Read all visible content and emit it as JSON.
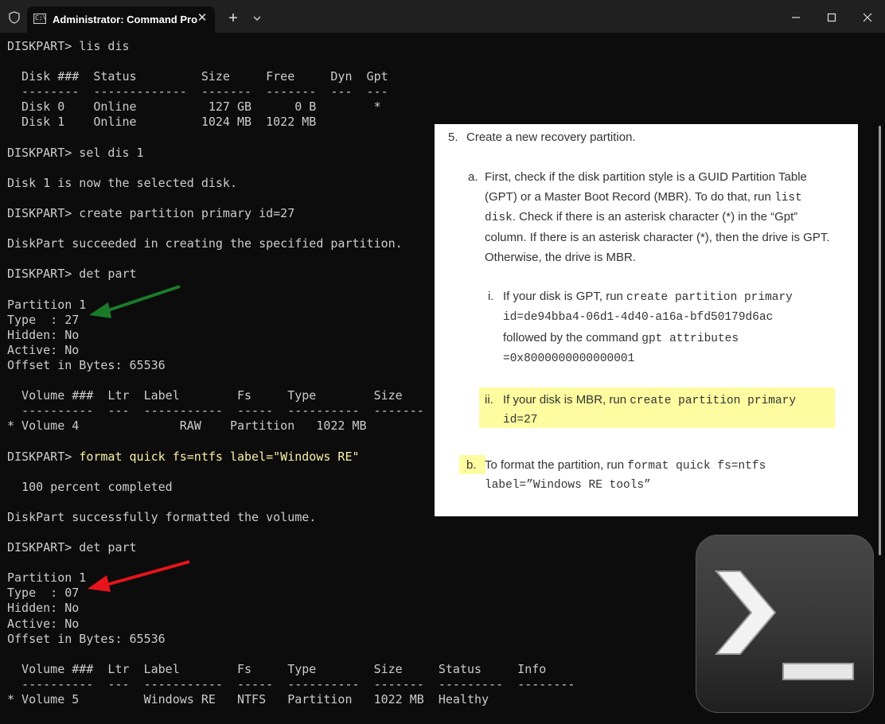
{
  "window": {
    "tab_title": "Administrator: Command Pro",
    "tab_icon_text": "C:\\",
    "tab_close": "✕",
    "new_tab": "+",
    "colors": {
      "titlebar": "#202020",
      "terminal_bg": "#0c0c0c",
      "terminal_text": "#cccccc",
      "prompt_highlight": "#f9f1a5"
    }
  },
  "terminal": {
    "lines": [
      "DISKPART> lis dis",
      "",
      "  Disk ###  Status         Size     Free     Dyn  Gpt",
      "  --------  -------------  -------  -------  ---  ---",
      "  Disk 0    Online          127 GB      0 B        *",
      "  Disk 1    Online         1024 MB  1022 MB",
      "",
      "DISKPART> sel dis 1",
      "",
      "Disk 1 is now the selected disk.",
      "",
      "DISKPART> create partition primary id=27",
      "",
      "DiskPart succeeded in creating the specified partition.",
      "",
      "DISKPART> det part",
      "",
      "Partition 1",
      "Type  : 27",
      "Hidden: No",
      "Active: No",
      "Offset in Bytes: 65536",
      "",
      "  Volume ###  Ltr  Label        Fs     Type        Size",
      "  ----------  ---  -----------  -----  ----------  -------",
      "* Volume 4              RAW    Partition   1022 MB",
      "",
      "",
      "",
      "  100 percent completed",
      "",
      "DiskPart successfully formatted the volume.",
      "",
      "DISKPART> det part",
      "",
      "Partition 1",
      "Type  : 07",
      "Hidden: No",
      "Active: No",
      "Offset in Bytes: 65536",
      "",
      "  Volume ###  Ltr  Label        Fs     Type        Size     Status     Info",
      "  ----------  ---  -----------  -----  ----------  -------  ---------  --------",
      "* Volume 5         Windows RE   NTFS   Partition   1022 MB  Healthy"
    ],
    "format_prompt": "DISKPART> ",
    "format_command": "format quick fs=ntfs label=\"Windows RE\""
  },
  "instructions": {
    "step5_num": "5.",
    "step5_text": "Create a new recovery partition.",
    "a_label": "a.",
    "a_line1": "First, check if the disk partition style is a GUID Partition Table",
    "a_line2_pre": "(GPT) or a Master Boot Record (MBR).  To do that, run ",
    "a_line2_code": "list",
    "a_line3_code": "disk",
    "a_line3_post": ". Check if there is an asterisk character (*) in the “Gpt”",
    "a_line4": "column.  If there is an asterisk character (*), then the drive is GPT.",
    "a_line5": "Otherwise, the drive is MBR.",
    "i_label": "i.",
    "i_line1_pre": "If your disk is GPT, run ",
    "i_line1_code": "create partition primary",
    "i_line2_code": "id=de94bba4-06d1-4d40-a16a-bfd50179d6ac",
    "i_line3_pre": "followed by the command ",
    "i_line3_code": "gpt attributes",
    "i_line4_code": "=0x8000000000000001",
    "ii_label": "ii.",
    "ii_line1_pre": "If your disk is MBR, run ",
    "ii_line1_code": "create partition primary",
    "ii_line2_code": "id=27",
    "b_label": "b.",
    "b_line1_pre": "To format the partition, run ",
    "b_line1_code": "format quick fs=ntfs",
    "b_line2_code": "label=”Windows RE tools”",
    "highlight_color": "#fefca0"
  },
  "annotations": {
    "arrow1_color": "#1a7a2a",
    "arrow2_color": "#e8141c"
  },
  "icons": [
    "shield-icon",
    "terminal-tab-icon",
    "close-icon",
    "plus-icon",
    "chevron-down-icon",
    "minimize-icon",
    "maximize-icon",
    "window-close-icon",
    "powershell-icon"
  ]
}
